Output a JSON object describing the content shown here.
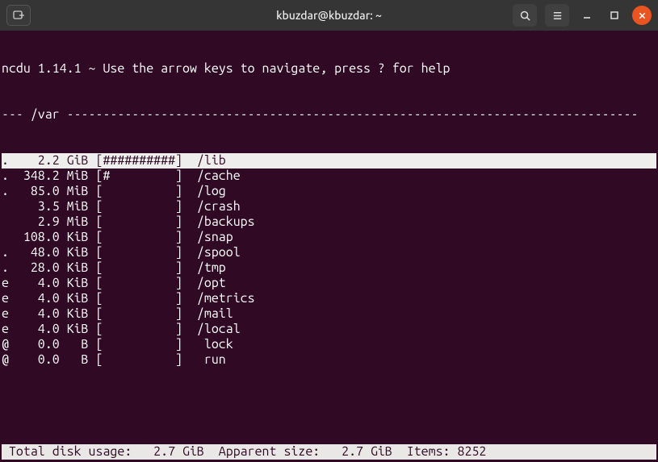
{
  "titlebar": {
    "title": "kbuzdar@kbuzdar: ~"
  },
  "header": {
    "program": "ncdu",
    "version": "1.14.1",
    "hint": "Use the arrow keys to navigate, press ? for help",
    "full": "ncdu 1.14.1 ~ Use the arrow keys to navigate, press ? for help"
  },
  "path": "/var",
  "path_line": "--- /var -------------------------------------------------------------------------------",
  "rows": [
    {
      "flag": ".",
      "size": "2.2",
      "unit": "GiB",
      "bar": "##########",
      "name": "/lib",
      "selected": true,
      "text": ".    2.2 GiB [##########]  /lib"
    },
    {
      "flag": ".",
      "size": "348.2",
      "unit": "MiB",
      "bar": "#         ",
      "name": "/cache",
      "selected": false,
      "text": ".  348.2 MiB [#         ]  /cache"
    },
    {
      "flag": ".",
      "size": "85.0",
      "unit": "MiB",
      "bar": "          ",
      "name": "/log",
      "selected": false,
      "text": ".   85.0 MiB [          ]  /log"
    },
    {
      "flag": " ",
      "size": "3.5",
      "unit": "MiB",
      "bar": "          ",
      "name": "/crash",
      "selected": false,
      "text": "     3.5 MiB [          ]  /crash"
    },
    {
      "flag": " ",
      "size": "2.9",
      "unit": "MiB",
      "bar": "          ",
      "name": "/backups",
      "selected": false,
      "text": "     2.9 MiB [          ]  /backups"
    },
    {
      "flag": " ",
      "size": "108.0",
      "unit": "KiB",
      "bar": "          ",
      "name": "/snap",
      "selected": false,
      "text": "   108.0 KiB [          ]  /snap"
    },
    {
      "flag": ".",
      "size": "48.0",
      "unit": "KiB",
      "bar": "          ",
      "name": "/spool",
      "selected": false,
      "text": ".   48.0 KiB [          ]  /spool"
    },
    {
      "flag": ".",
      "size": "28.0",
      "unit": "KiB",
      "bar": "          ",
      "name": "/tmp",
      "selected": false,
      "text": ".   28.0 KiB [          ]  /tmp"
    },
    {
      "flag": "e",
      "size": "4.0",
      "unit": "KiB",
      "bar": "          ",
      "name": "/opt",
      "selected": false,
      "text": "e    4.0 KiB [          ]  /opt"
    },
    {
      "flag": "e",
      "size": "4.0",
      "unit": "KiB",
      "bar": "          ",
      "name": "/metrics",
      "selected": false,
      "text": "e    4.0 KiB [          ]  /metrics"
    },
    {
      "flag": "e",
      "size": "4.0",
      "unit": "KiB",
      "bar": "          ",
      "name": "/mail",
      "selected": false,
      "text": "e    4.0 KiB [          ]  /mail"
    },
    {
      "flag": "e",
      "size": "4.0",
      "unit": "KiB",
      "bar": "          ",
      "name": "/local",
      "selected": false,
      "text": "e    4.0 KiB [          ]  /local"
    },
    {
      "flag": "@",
      "size": "0.0",
      "unit": "B",
      "bar": "          ",
      "name": "lock",
      "selected": false,
      "text": "@    0.0   B [          ]   lock"
    },
    {
      "flag": "@",
      "size": "0.0",
      "unit": "B",
      "bar": "          ",
      "name": "run",
      "selected": false,
      "text": "@    0.0   B [          ]   run"
    }
  ],
  "footer": {
    "total_label": "Total disk usage:",
    "total_value": "2.7 GiB",
    "apparent_label": "Apparent size:",
    "apparent_value": "2.7 GiB",
    "items_label": "Items:",
    "items_value": "8252",
    "full": " Total disk usage:   2.7 GiB  Apparent size:   2.7 GiB  Items: 8252"
  }
}
